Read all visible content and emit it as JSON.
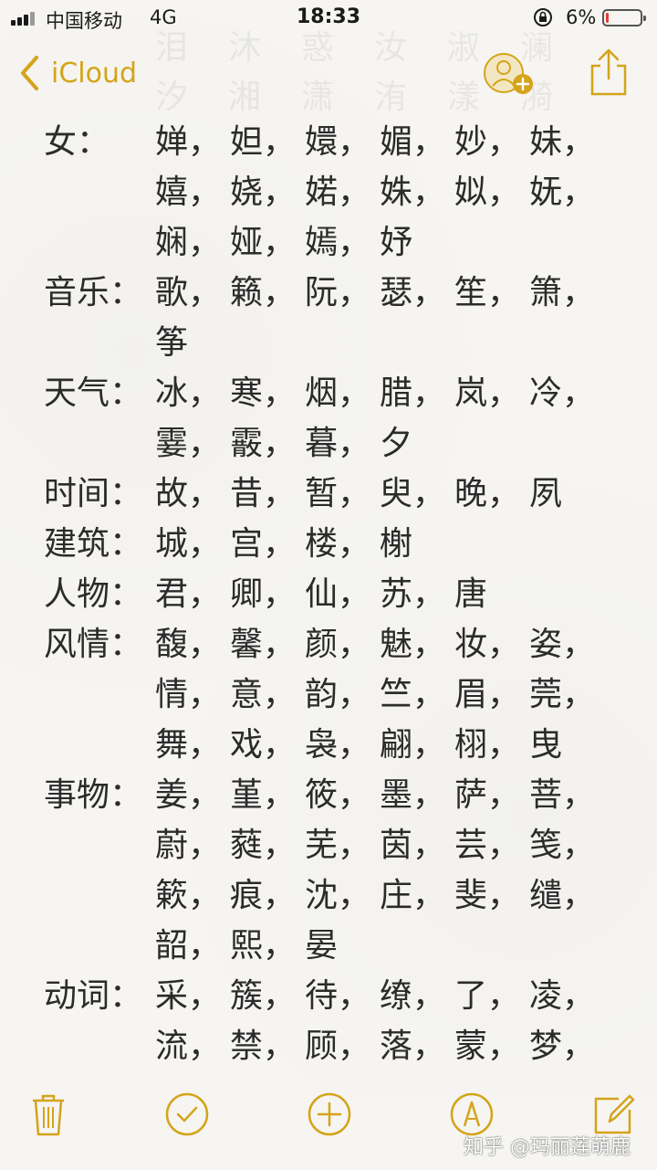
{
  "status_bar": {
    "carrier": "中国移动",
    "network": "4G",
    "time": "18:33",
    "battery_percent_text": "6%",
    "battery_level": 0.06,
    "battery_color": "#e53935"
  },
  "nav": {
    "back_label": "iCloud",
    "accent_color": "#d4a419",
    "icons": [
      "chevron-left-icon",
      "add-person-icon",
      "share-icon"
    ]
  },
  "note": {
    "sections": [
      {
        "category": "女：",
        "lines": [
          [
            "婵，",
            "妲，",
            "嬛，",
            "媚，",
            "妙，",
            "妹，"
          ],
          [
            "嬉，",
            "娆，",
            "婼，",
            "姝，",
            "姒，",
            "妩，"
          ],
          [
            "娴，",
            "娅，",
            "嫣，",
            "妤"
          ]
        ]
      },
      {
        "category": "音乐：",
        "lines": [
          [
            "歌，",
            "籁，",
            "阮，",
            "瑟，",
            "笙，",
            "箫，"
          ],
          [
            "筝"
          ]
        ]
      },
      {
        "category": "天气：",
        "lines": [
          [
            "冰，",
            "寒，",
            "烟，",
            "腊，",
            "岚，",
            "冷，"
          ],
          [
            "霎，",
            "霰，",
            "暮，",
            "夕"
          ]
        ]
      },
      {
        "category": "时间：",
        "lines": [
          [
            "故，",
            "昔，",
            "暂，",
            "臾，",
            "晚，",
            "夙"
          ]
        ]
      },
      {
        "category": "建筑：",
        "lines": [
          [
            "城，",
            "宫，",
            "楼，",
            "榭"
          ]
        ]
      },
      {
        "category": "人物：",
        "lines": [
          [
            "君，",
            "卿，",
            "仙，",
            "苏，",
            "唐"
          ]
        ]
      },
      {
        "category": "风情：",
        "lines": [
          [
            "馥，",
            "馨，",
            "颜，",
            "魅，",
            "妆，",
            "姿，"
          ],
          [
            "情，",
            "意，",
            "韵，",
            "竺，",
            "眉，",
            "莞，"
          ],
          [
            "舞，",
            "戏，",
            "袅，",
            "翩，",
            "栩，",
            "曳"
          ]
        ]
      },
      {
        "category": "事物：",
        "lines": [
          [
            "姜，",
            "堇，",
            "筱，",
            "墨，",
            "萨，",
            "菩，"
          ],
          [
            "蔚，",
            "蕤，",
            "芜，",
            "茵，",
            "芸，",
            "笺，"
          ],
          [
            "簌，",
            "痕，",
            "沈，",
            "庄，",
            "斐，",
            "缱，"
          ],
          [
            "韶，",
            "熙，",
            "晏"
          ]
        ]
      },
      {
        "category": "动词：",
        "lines": [
          [
            "采，",
            "簇，",
            "待，",
            "缭，",
            "了，",
            "凌，"
          ],
          [
            "流，",
            "禁，",
            "顾，",
            "落，",
            "蒙，",
            "梦，"
          ]
        ]
      }
    ]
  },
  "toolbar": {
    "icons": [
      "trash-icon",
      "checklist-icon",
      "add-icon",
      "markup-pen-icon",
      "compose-icon"
    ]
  },
  "watermark": "知乎 @玛丽莲萌鹿"
}
